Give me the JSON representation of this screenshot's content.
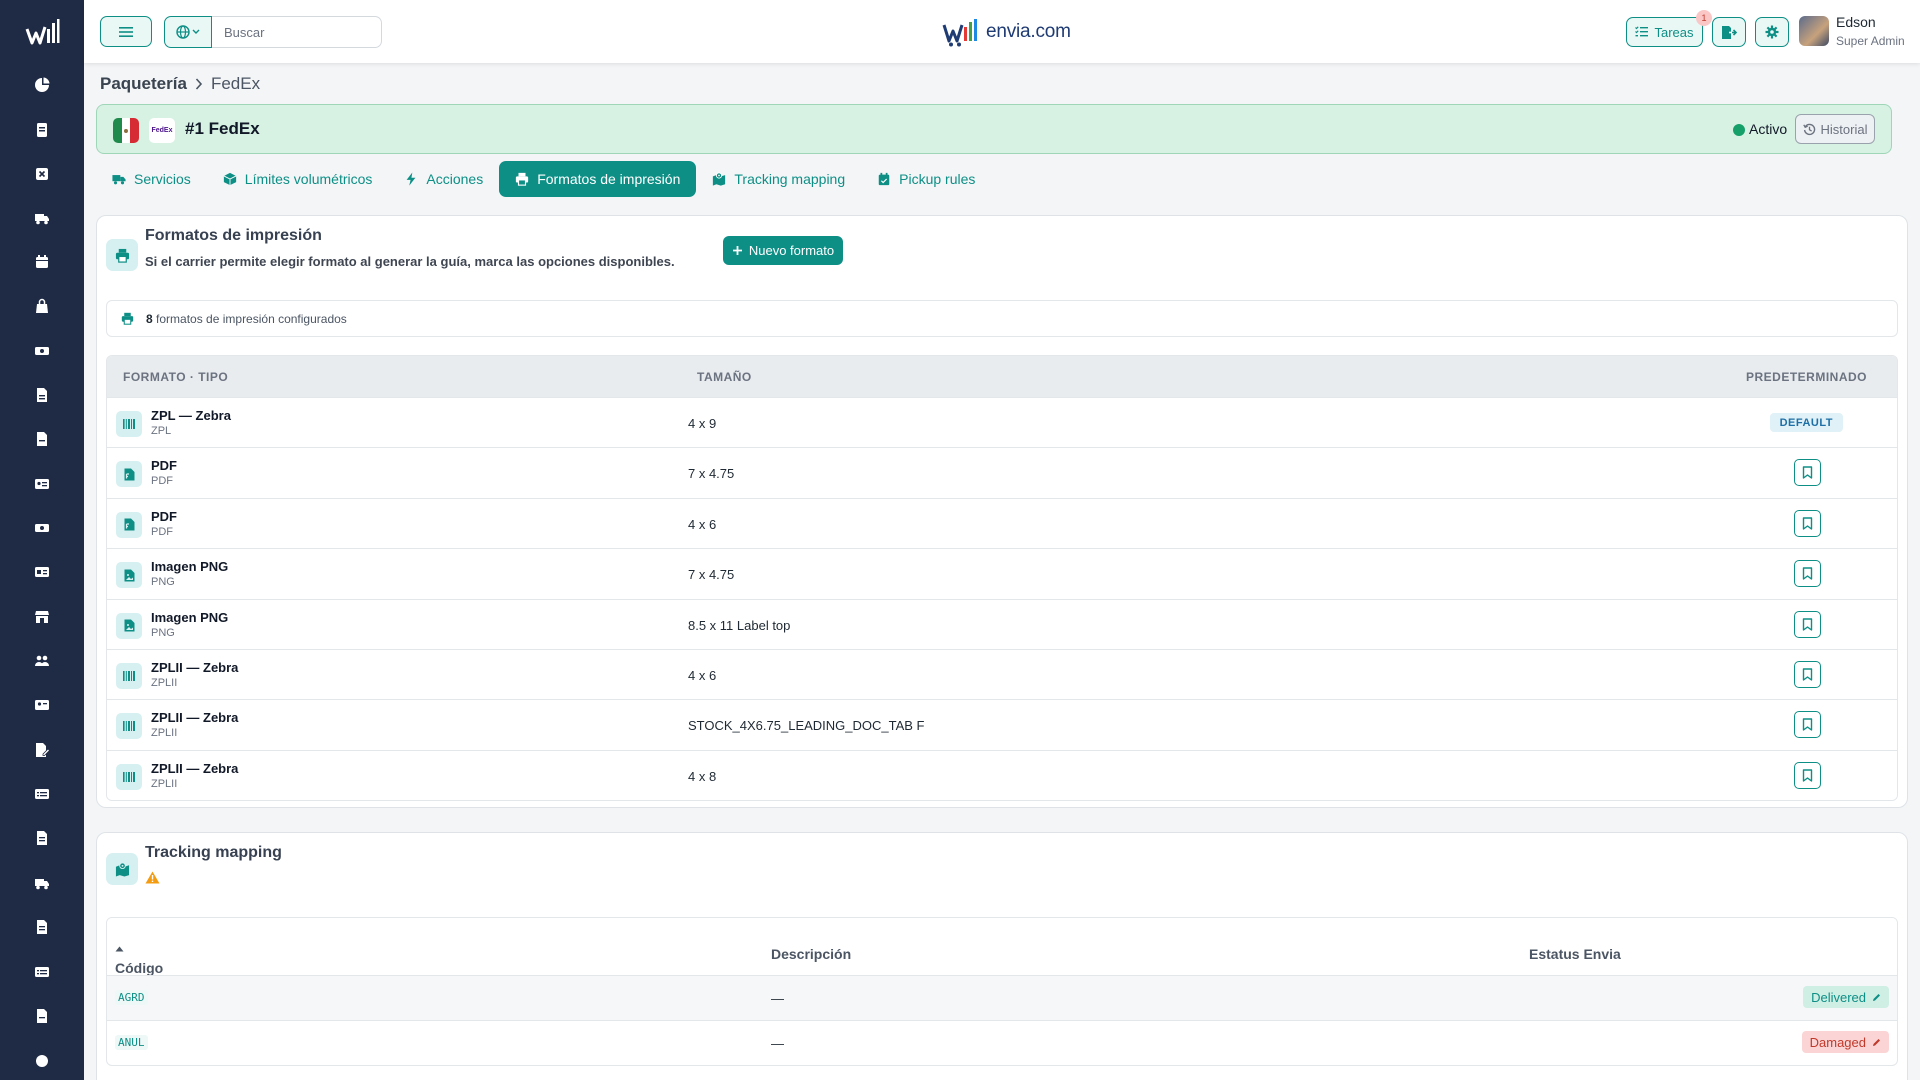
{
  "search": {
    "placeholder": "Buscar"
  },
  "brand": {
    "name": "envia.com"
  },
  "header": {
    "tasks_label": "Tareas",
    "tasks_count": "1",
    "user_name": "Edson",
    "user_role": "Super Admin"
  },
  "breadcrumb": {
    "parent": "Paquetería",
    "current": "FedEx"
  },
  "carrier": {
    "logo_text": "FedEx",
    "title": "#1 FedEx",
    "status": "Activo",
    "history_label": "Historial"
  },
  "tabs": [
    {
      "label": "Servicios",
      "icon": "truck-icon"
    },
    {
      "label": "Límites volumétricos",
      "icon": "box-icon"
    },
    {
      "label": "Acciones",
      "icon": "bolt-icon"
    },
    {
      "label": "Formatos de impresión",
      "icon": "printer-icon"
    },
    {
      "label": "Tracking mapping",
      "icon": "map-icon"
    },
    {
      "label": "Pickup rules",
      "icon": "calendar-icon"
    }
  ],
  "print_formats": {
    "title": "Formatos de impresión",
    "subtitle": "Si el carrier permite elegir formato al generar la guía, marca las opciones disponibles.",
    "new_button": "Nuevo formato",
    "count": "8",
    "count_suffix": "formatos de impresión configurados",
    "columns": [
      "FORMATO · TIPO",
      "TAMAÑO",
      "PREDETERMINADO"
    ],
    "default_label": "DEFAULT",
    "rows": [
      {
        "name": "ZPL — Zebra",
        "type": "ZPL",
        "size": "4 x 9",
        "icon": "barcode-icon",
        "is_default": true
      },
      {
        "name": "PDF",
        "type": "PDF",
        "size": "7 x 4.75",
        "icon": "pdf-file-icon",
        "is_default": false
      },
      {
        "name": "PDF",
        "type": "PDF",
        "size": "4 x 6",
        "icon": "pdf-file-icon",
        "is_default": false
      },
      {
        "name": "Imagen PNG",
        "type": "PNG",
        "size": "7 x 4.75",
        "icon": "image-file-icon",
        "is_default": false
      },
      {
        "name": "Imagen PNG",
        "type": "PNG",
        "size": "8.5 x 11 Label top",
        "icon": "image-file-icon",
        "is_default": false
      },
      {
        "name": "ZPLII — Zebra",
        "type": "ZPLII",
        "size": "4 x 6",
        "icon": "barcode-icon",
        "is_default": false
      },
      {
        "name": "ZPLII — Zebra",
        "type": "ZPLII",
        "size": "STOCK_4X6.75_LEADING_DOC_TAB F",
        "icon": "barcode-icon",
        "is_default": false
      },
      {
        "name": "ZPLII — Zebra",
        "type": "ZPLII",
        "size": "4 x 8",
        "icon": "barcode-icon",
        "is_default": false
      }
    ]
  },
  "tracking": {
    "title": "Tracking mapping",
    "columns": [
      "Código carrier",
      "Descripción",
      "Estatus Envia"
    ],
    "rows": [
      {
        "code": "AGRD",
        "description": "—",
        "status": "Delivered",
        "status_color": "#0e8f86"
      },
      {
        "code": "ANUL",
        "description": "—",
        "status": "Damaged",
        "status_color": "#c0392b"
      }
    ]
  },
  "colors": {
    "accent": "#0e8f86",
    "sidebar": "#1f2a44",
    "active_status": "#15a06a"
  }
}
